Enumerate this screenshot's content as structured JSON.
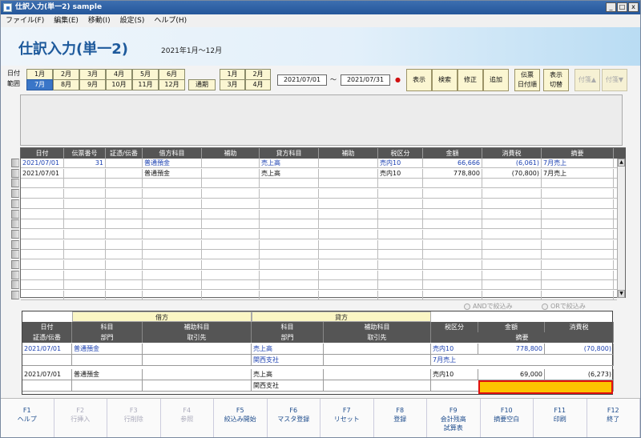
{
  "window": {
    "title": "仕訳入力(単一2) sample",
    "buttons": [
      "_",
      "□",
      "x"
    ]
  },
  "menu": [
    "ファイル(F)",
    "編集(E)",
    "移動(I)",
    "設定(S)",
    "ヘルプ(H)"
  ],
  "header": {
    "title": "仕訳入力(単一2)",
    "range": "2021年1月～12月"
  },
  "filter": {
    "label_date": "日付",
    "label_range": "範囲",
    "months_row1": [
      "1月",
      "2月",
      "3月",
      "4月",
      "5月",
      "6月"
    ],
    "months_row2": [
      "7月",
      "8月",
      "9月",
      "10月",
      "11月",
      "12月"
    ],
    "selected_month": "7月",
    "tsuki_label": "通期",
    "quarters_row1": [
      "1月",
      "2月"
    ],
    "quarters_row2": [
      "3月",
      "4月"
    ],
    "date_from": "2021/07/01",
    "tilde": "～",
    "date_to": "2021/07/31",
    "red_dot": "●"
  },
  "actions": {
    "display": "表示",
    "search": "検索",
    "modify": "修正",
    "add": "追加",
    "voucher_line1": "伝票",
    "voucher_line2": "日付順",
    "toggle_line1": "表示",
    "toggle_line2": "切替",
    "sort_up": "付箋▲",
    "sort_down": "付箋▼"
  },
  "grid": {
    "columns": [
      "日付",
      "伝票番号",
      "証憑/伝番",
      "借方科目",
      "補助",
      "貸方科目",
      "補助",
      "税区分",
      "金額",
      "消費税",
      "摘要"
    ],
    "rows": [
      {
        "date": "2021/07/01",
        "voucher_no": "31",
        "evidence": "",
        "debit": "普通預金",
        "debit_sub": "",
        "credit": "売上高",
        "credit_sub": "",
        "tax": "売内10",
        "amount": "66,666",
        "ctax": "(6,061)",
        "memo": "7月売上"
      },
      {
        "date": "2021/07/01",
        "voucher_no": "",
        "evidence": "",
        "debit": "普通預金",
        "debit_sub": "",
        "credit": "売上高",
        "credit_sub": "",
        "tax": "売内10",
        "amount": "778,800",
        "ctax": "(70,800)",
        "memo": "7月売上"
      }
    ],
    "empty_rows": 12,
    "scroll_up": "▲",
    "scroll_down": "▼"
  },
  "options": {
    "and_label": "ANDで絞込み",
    "or_label": "ORで絞込み"
  },
  "detail": {
    "debit_header": "借方",
    "credit_header": "貸方",
    "row1_headers": [
      "日付",
      "科目",
      "補助科目",
      "科目",
      "補助科目",
      "税区分",
      "金額",
      "消費税"
    ],
    "row2_headers": [
      "証憑/伝番",
      "部門",
      "取引先",
      "部門",
      "取引先",
      "摘要"
    ],
    "entries": [
      {
        "date": "2021/07/01",
        "debit": "普通預金",
        "credit": "売上高",
        "credit_dept": "関西支社",
        "tax": "売内10",
        "amount": "778,800",
        "ctax": "(70,800)",
        "memo": "7月売上"
      },
      {
        "date": "2021/07/01",
        "debit": "普通預金",
        "credit": "売上高",
        "credit_dept": "関西支社",
        "tax": "売内10",
        "amount": "69,000",
        "ctax": "(6,273)",
        "memo": ""
      }
    ]
  },
  "fkeys": [
    {
      "key": "F1",
      "label": "ヘルプ",
      "label2": "",
      "enabled": true
    },
    {
      "key": "F2",
      "label": "行挿入",
      "label2": "",
      "enabled": false
    },
    {
      "key": "F3",
      "label": "行削除",
      "label2": "",
      "enabled": false
    },
    {
      "key": "F4",
      "label": "参照",
      "label2": "",
      "enabled": false
    },
    {
      "key": "F5",
      "label": "絞込み開始",
      "label2": "",
      "enabled": true
    },
    {
      "key": "F6",
      "label": "マスタ登録",
      "label2": "",
      "enabled": true
    },
    {
      "key": "F7",
      "label": "リセット",
      "label2": "",
      "enabled": true
    },
    {
      "key": "F8",
      "label": "登録",
      "label2": "",
      "enabled": true
    },
    {
      "key": "F9",
      "label": "会計残高",
      "label2": "試算表",
      "enabled": true
    },
    {
      "key": "F10",
      "label": "摘要空白",
      "label2": "",
      "enabled": true
    },
    {
      "key": "F11",
      "label": "印刷",
      "label2": "",
      "enabled": true
    },
    {
      "key": "F12",
      "label": "終了",
      "label2": "",
      "enabled": true
    }
  ]
}
